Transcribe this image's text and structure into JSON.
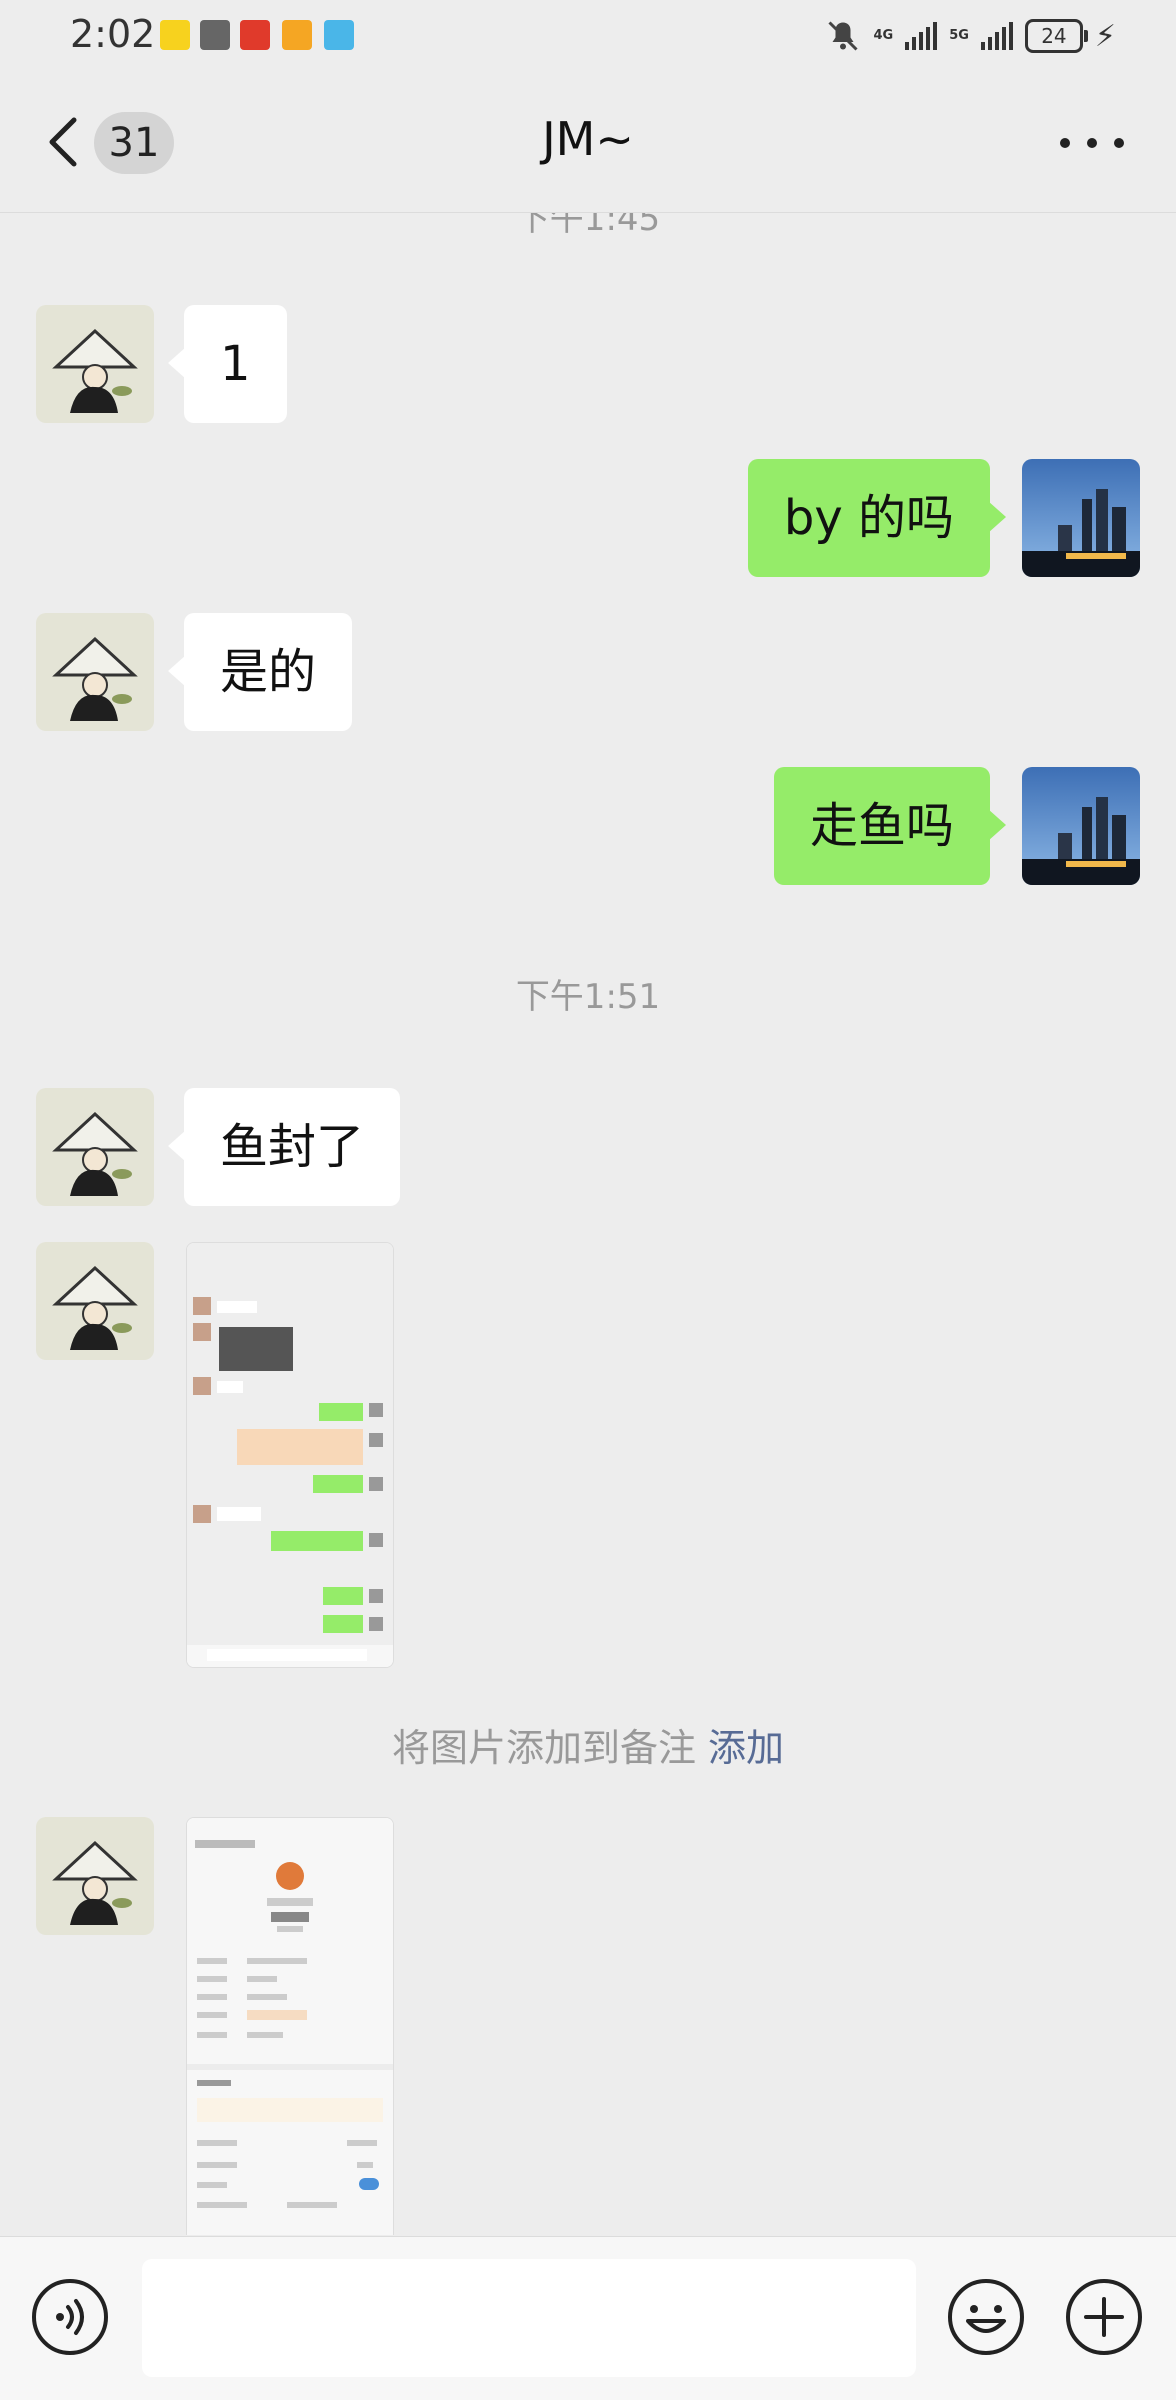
{
  "status_bar": {
    "time": "2:02",
    "network_1": "4G",
    "network_2": "5G",
    "battery": "24"
  },
  "header": {
    "unread_count": "31",
    "title": "JM~"
  },
  "messages": {
    "ts_top": "下午1:45",
    "m1": "1",
    "m2": "by 的吗",
    "m3": "是的",
    "m4": "走鱼吗",
    "ts_2": "下午1:51",
    "m5": "鱼封了"
  },
  "system_note": {
    "text": "将图片添加到备注 ",
    "link": "添加"
  },
  "colors": {
    "background": "#ededed",
    "bubble_out": "#95ec69",
    "bubble_in": "#ffffff",
    "link": "#576b95"
  },
  "icons": {
    "back": "chevron-left-icon",
    "more": "more-dots-icon",
    "voice": "voice-icon",
    "emoji": "emoji-icon",
    "plus": "plus-icon"
  }
}
